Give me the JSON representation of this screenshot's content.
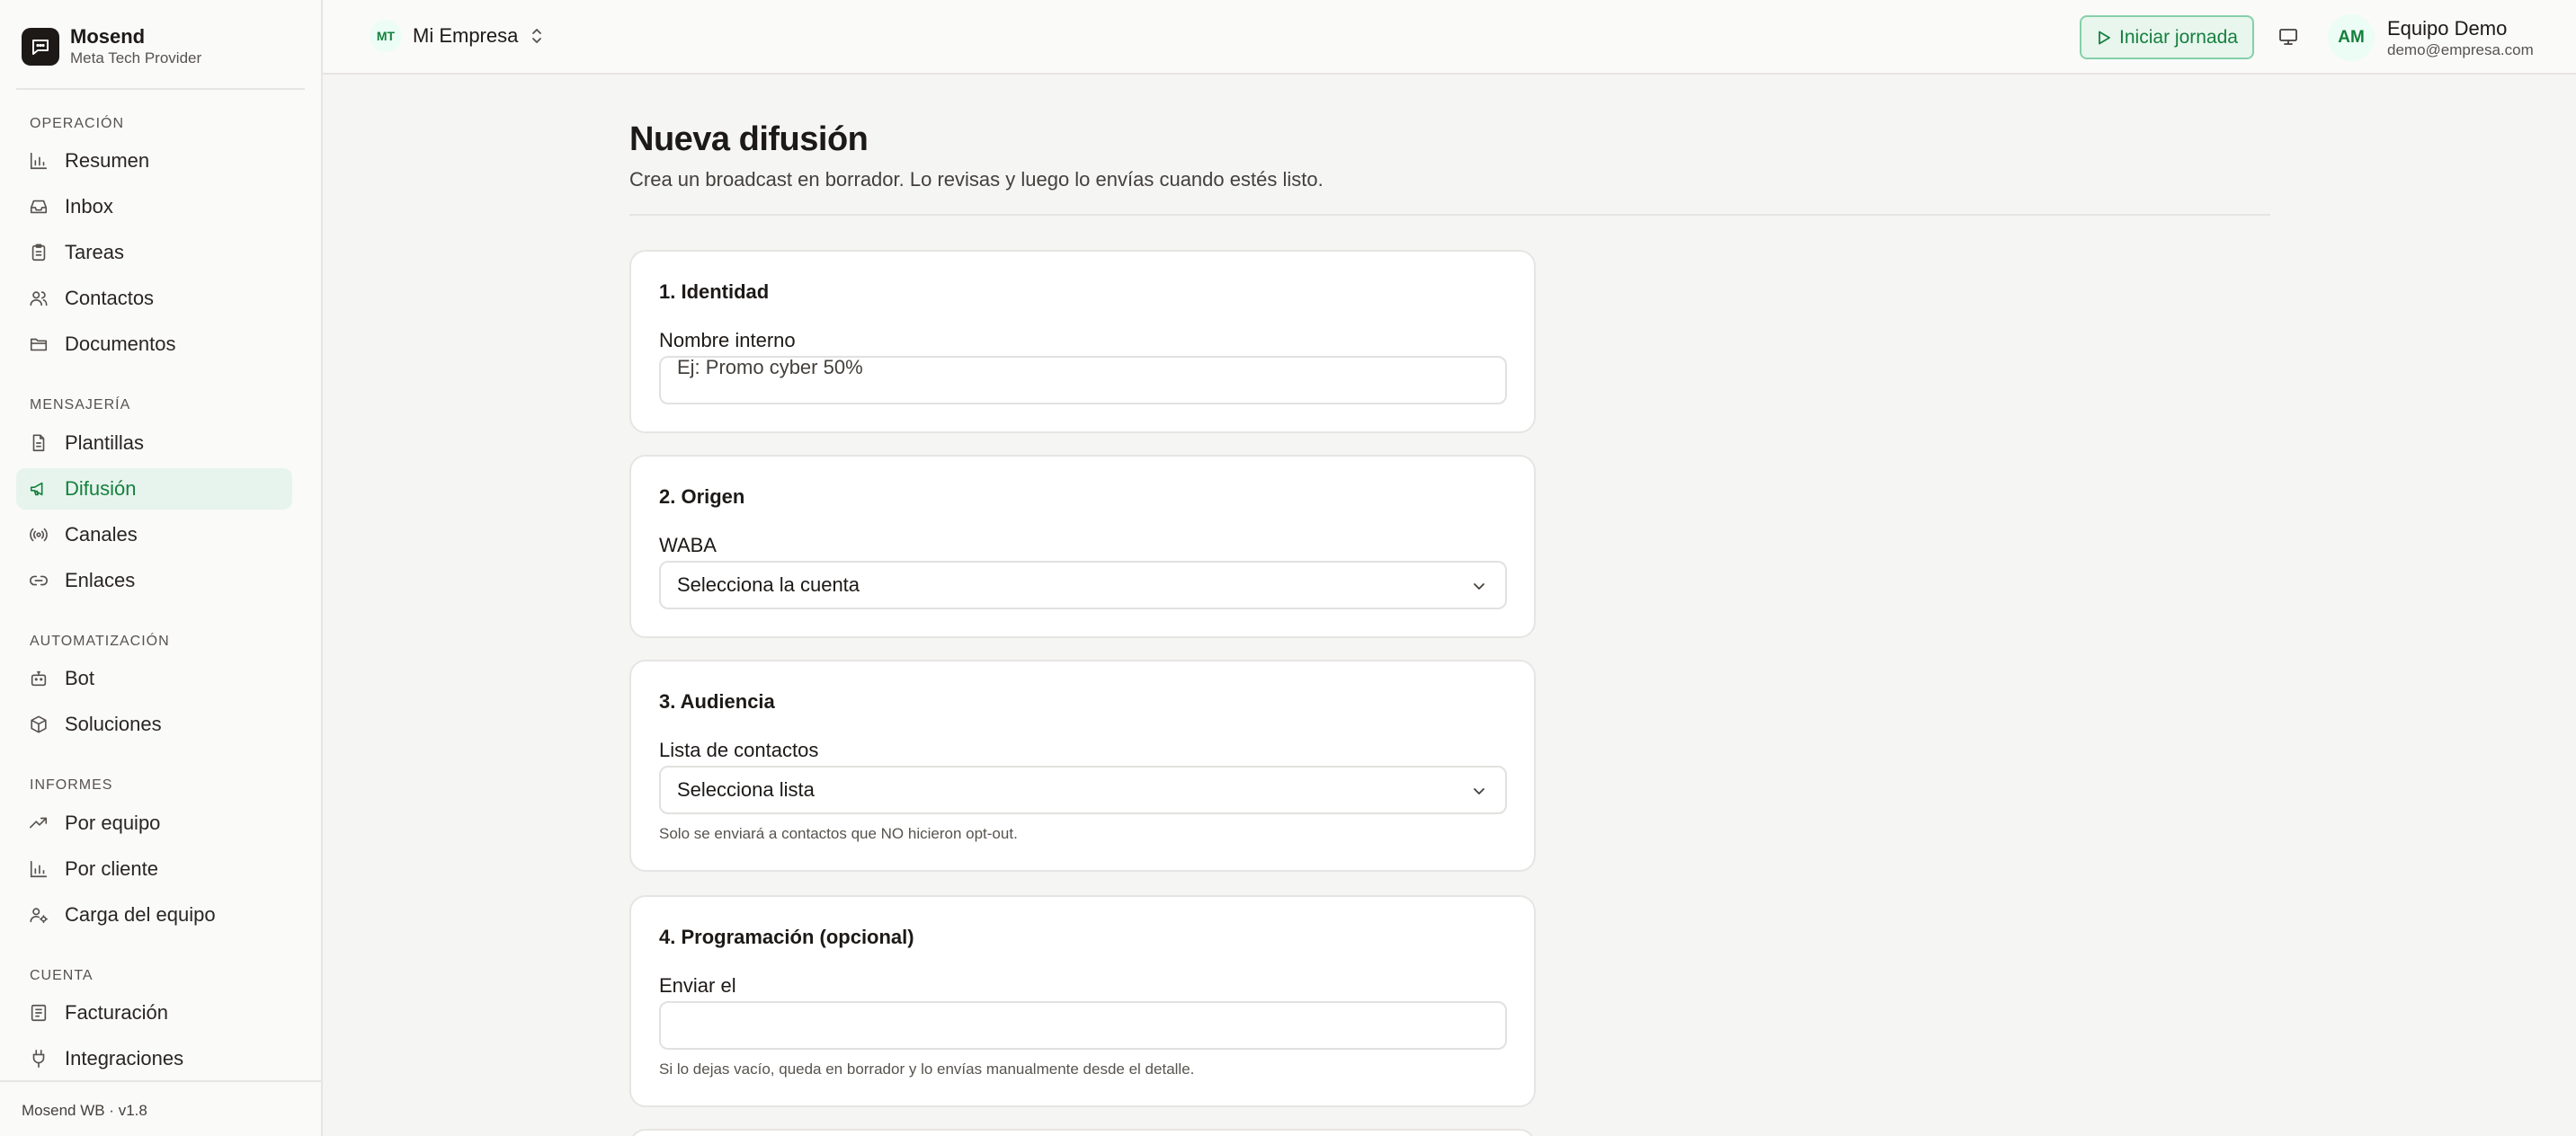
{
  "brand": {
    "name": "Mosend",
    "subtitle": "Meta Tech Provider"
  },
  "sidebar": {
    "sections": [
      {
        "title": "OPERACIÓN",
        "items": [
          {
            "label": "Resumen",
            "icon": "bar-chart-icon"
          },
          {
            "label": "Inbox",
            "icon": "inbox-icon"
          },
          {
            "label": "Tareas",
            "icon": "clipboard-icon"
          },
          {
            "label": "Contactos",
            "icon": "users-icon"
          },
          {
            "label": "Documentos",
            "icon": "folder-icon"
          }
        ]
      },
      {
        "title": "MENSAJERÍA",
        "items": [
          {
            "label": "Plantillas",
            "icon": "file-text-icon"
          },
          {
            "label": "Difusión",
            "icon": "megaphone-icon",
            "active": true
          },
          {
            "label": "Canales",
            "icon": "radio-icon"
          },
          {
            "label": "Enlaces",
            "icon": "link-icon"
          }
        ]
      },
      {
        "title": "AUTOMATIZACIÓN",
        "items": [
          {
            "label": "Bot",
            "icon": "bot-icon"
          },
          {
            "label": "Soluciones",
            "icon": "package-icon"
          }
        ]
      },
      {
        "title": "INFORMES",
        "items": [
          {
            "label": "Por equipo",
            "icon": "trending-up-icon"
          },
          {
            "label": "Por cliente",
            "icon": "bar-chart-icon"
          },
          {
            "label": "Carga del equipo",
            "icon": "user-cog-icon"
          }
        ]
      },
      {
        "title": "CUENTA",
        "items": [
          {
            "label": "Facturación",
            "icon": "receipt-icon"
          },
          {
            "label": "Integraciones",
            "icon": "plug-icon"
          }
        ]
      }
    ],
    "footer": "Mosend WB · v1.8"
  },
  "topbar": {
    "org_badge": "MT",
    "org_name": "Mi Empresa",
    "start_button": "Iniciar jornada",
    "user_initials": "AM",
    "user_name": "Equipo Demo",
    "user_email": "demo@empresa.com"
  },
  "page": {
    "title": "Nueva difusión",
    "subtitle": "Crea un broadcast en borrador. Lo revisas y luego lo envías cuando estés listo."
  },
  "form": {
    "identity": {
      "title": "1. Identidad",
      "name_label": "Nombre interno",
      "name_placeholder": "Ej: Promo cyber 50%"
    },
    "origin": {
      "title": "2. Origen",
      "waba_label": "WABA",
      "waba_value": "Selecciona la cuenta"
    },
    "audience": {
      "title": "3. Audiencia",
      "list_label": "Lista de contactos",
      "list_value": "Selecciona lista",
      "hint": "Solo se enviará a contactos que NO hicieron opt-out."
    },
    "schedule": {
      "title": "4. Programación (opcional)",
      "send_label": "Enviar el",
      "send_value": "",
      "hint": "Si lo dejas vacío, queda en borrador y lo envías manualmente desde el detalle."
    }
  },
  "colors": {
    "accent": "#15803d",
    "active_bg": "#e7f4ee",
    "page_bg": "#f5f5f4"
  }
}
